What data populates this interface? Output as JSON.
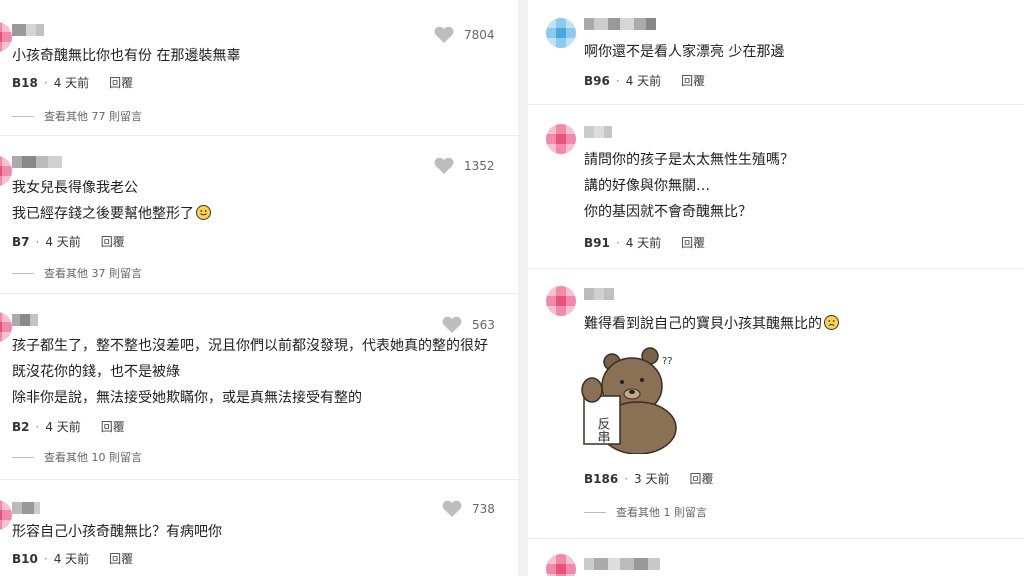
{
  "left_comments": [
    {
      "lines": [
        "小孩奇醜無比你也有份 在那邊裝無辜"
      ],
      "floor": "B18",
      "time": "4 天前",
      "reply": "回覆",
      "likes": "7804",
      "more": "查看其他 77 則留言"
    },
    {
      "lines": [
        "我女兒長得像我老公",
        "我已經存錢之後要幫他整形了"
      ],
      "emoji_line": 1,
      "floor": "B7",
      "time": "4 天前",
      "reply": "回覆",
      "likes": "1352",
      "more": "查看其他 37 則留言"
    },
    {
      "lines": [
        "孩子都生了，整不整也沒差吧，況且你們以前都沒發現，代表她真的整的很好",
        "既沒花你的錢，也不是被綠",
        "除非你是說，無法接受她欺瞞你，或是真無法接受有整的"
      ],
      "floor": "B2",
      "time": "4 天前",
      "reply": "回覆",
      "likes": "563",
      "more": "查看其他 10 則留言"
    },
    {
      "lines": [
        "形容自己小孩奇醜無比？有病吧你"
      ],
      "floor": "B10",
      "time": "4 天前",
      "reply": "回覆",
      "likes": "738"
    }
  ],
  "right_comments": [
    {
      "lines": [
        "啊你還不是看人家漂亮 少在那邊"
      ],
      "floor": "B96",
      "time": "4 天前",
      "reply": "回覆"
    },
    {
      "lines": [
        "請問你的孩子是太太無性生殖嗎？",
        "講的好像與你無關…",
        "你的基因就不會奇醜無比？"
      ],
      "floor": "B91",
      "time": "4 天前",
      "reply": "回覆"
    },
    {
      "lines": [
        "難得看到說自己的寶貝小孩其醜無比的"
      ],
      "emoji_line": 0,
      "floor": "B186",
      "time": "3 天前",
      "reply": "回覆",
      "more": "查看其他 1 則留言",
      "sticker": {
        "sign_text": "反串",
        "mark": "??"
      }
    }
  ],
  "colors": {
    "avatar_pink": "#e8517a",
    "avatar_blue": "#4aa8e0",
    "heart": "#bdbdbd",
    "divider": "#ececec"
  },
  "icons": {
    "like": "heart-icon",
    "reaction": "smiley-icon",
    "sticker": "bear-sticker"
  }
}
